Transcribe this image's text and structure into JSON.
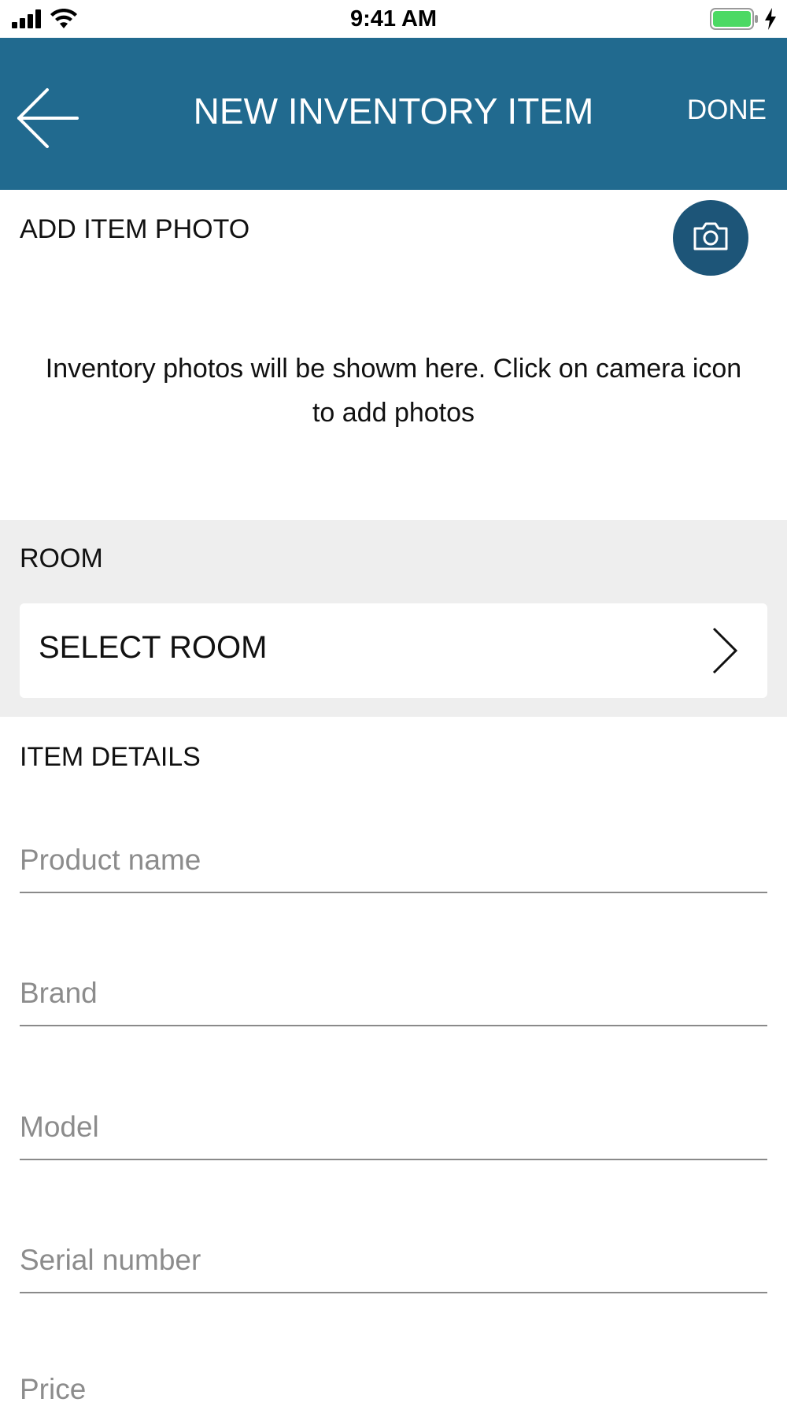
{
  "status_bar": {
    "time": "9:41 AM"
  },
  "nav_bar": {
    "title": "NEW INVENTORY ITEM",
    "done_label": "DONE",
    "back_icon": "arrow-left-icon",
    "background_color": "#216a8f"
  },
  "photo_section": {
    "heading": "ADD ITEM PHOTO",
    "camera_icon": "camera-icon",
    "hint": "Inventory photos will be showm here. Click on camera icon to add photos"
  },
  "room_section": {
    "heading": "ROOM",
    "select_label": "SELECT ROOM",
    "select_icon": "chevron-right-icon"
  },
  "details_section": {
    "heading": "ITEM DETAILS",
    "fields": [
      {
        "placeholder": "Product name",
        "value": ""
      },
      {
        "placeholder": "Brand",
        "value": ""
      },
      {
        "placeholder": "Model",
        "value": ""
      },
      {
        "placeholder": "Serial number",
        "value": ""
      },
      {
        "placeholder": "Price",
        "value": ""
      }
    ]
  }
}
